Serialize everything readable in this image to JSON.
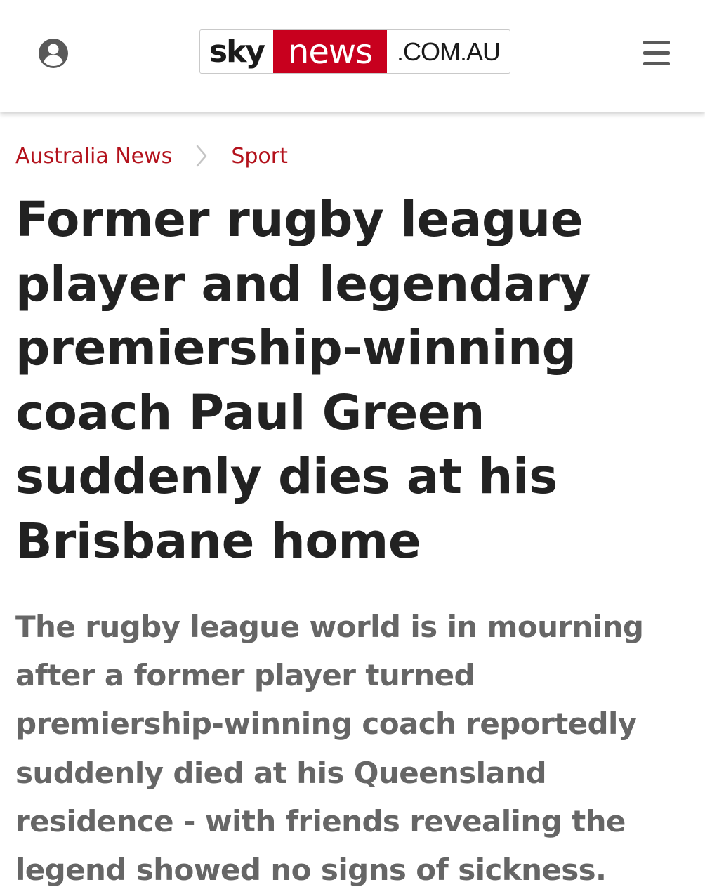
{
  "header": {
    "account_icon": "user-circle-icon",
    "logo": {
      "sky": "sky",
      "news": "news",
      "domain": ".COM.AU"
    },
    "menu_icon": "hamburger-menu-icon"
  },
  "breadcrumb": {
    "items": [
      "Australia News",
      "Sport"
    ],
    "separator_icon": "chevron-right-icon"
  },
  "article": {
    "headline_lines": [
      "Former rugby league",
      "player and legendary",
      "premiership-winning",
      "coach Paul Green",
      "suddenly dies at his",
      "Brisbane home"
    ],
    "standfirst_lines": [
      "The rugby league world is in mourning",
      "after a former player turned",
      "premiership-winning coach reportedly",
      "suddenly died at his Queensland",
      "residence - with friends revealing the",
      "legend showed no signs of sickness."
    ]
  },
  "colors": {
    "brand_red": "#c8001e",
    "link_red": "#b3121c",
    "headline": "#222222",
    "standfirst": "#666666",
    "icon_grey": "#5a5a5a"
  }
}
